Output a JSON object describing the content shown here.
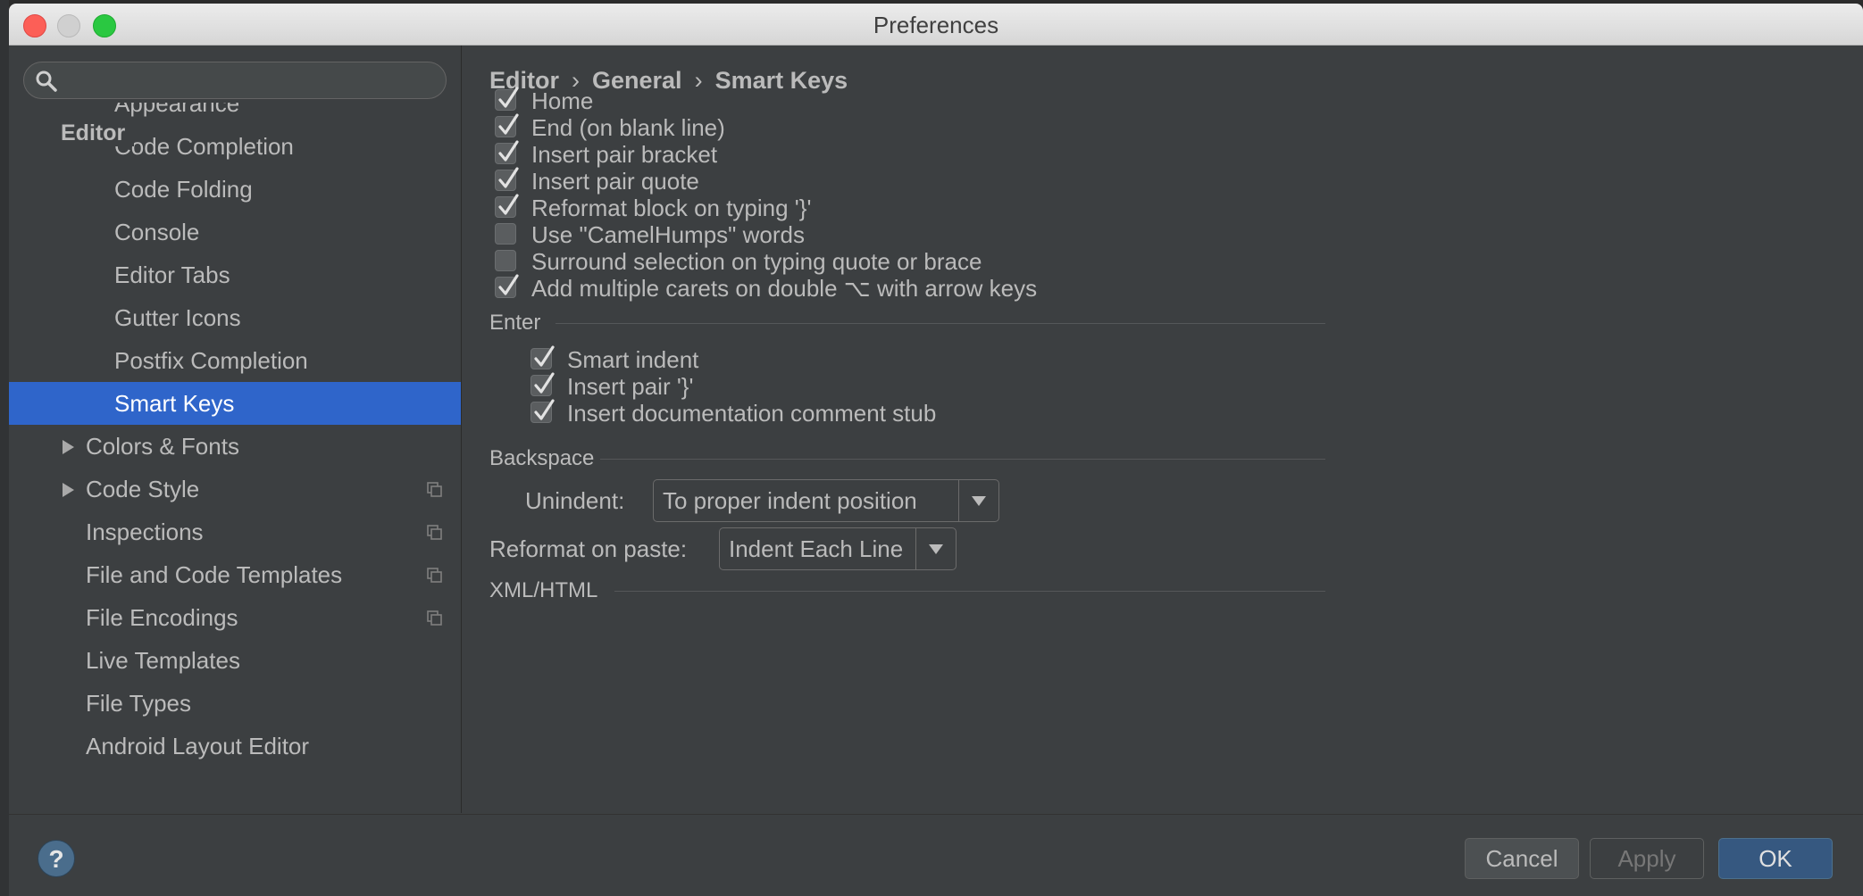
{
  "window": {
    "title": "Preferences"
  },
  "sidebar": {
    "search": {
      "placeholder": ""
    },
    "header": "Editor",
    "items": [
      {
        "label": "Appearance",
        "partial": true
      },
      {
        "label": "Code Completion"
      },
      {
        "label": "Code Folding"
      },
      {
        "label": "Console"
      },
      {
        "label": "Editor Tabs"
      },
      {
        "label": "Gutter Icons"
      },
      {
        "label": "Postfix Completion"
      },
      {
        "label": "Smart Keys",
        "selected": true
      },
      {
        "label": "Colors & Fonts",
        "expandable": true
      },
      {
        "label": "Code Style",
        "expandable": true,
        "project_icon": true
      },
      {
        "label": "Inspections",
        "project_icon": true
      },
      {
        "label": "File and Code Templates",
        "project_icon": true
      },
      {
        "label": "File Encodings",
        "project_icon": true
      },
      {
        "label": "Live Templates"
      },
      {
        "label": "File Types"
      },
      {
        "label": "Android Layout Editor"
      }
    ]
  },
  "breadcrumb": [
    "Editor",
    "General",
    "Smart Keys"
  ],
  "options": [
    {
      "label": "Home",
      "checked": true
    },
    {
      "label": "End (on blank line)",
      "checked": true
    },
    {
      "label": "Insert pair bracket",
      "checked": true
    },
    {
      "label": "Insert pair quote",
      "checked": true
    },
    {
      "label": "Reformat block on typing '}'",
      "checked": true
    },
    {
      "label": "Use \"CamelHumps\" words",
      "checked": false
    },
    {
      "label": "Surround selection on typing quote or brace",
      "checked": false
    },
    {
      "label": "Add multiple carets on double ⌥ with arrow keys",
      "checked": true
    }
  ],
  "enter": {
    "title": "Enter",
    "options": [
      {
        "label": "Smart indent",
        "checked": true
      },
      {
        "label": "Insert pair '}'",
        "checked": true
      },
      {
        "label": "Insert documentation comment stub",
        "checked": true
      }
    ]
  },
  "backspace": {
    "title": "Backspace",
    "unindent_label": "Unindent:",
    "unindent_value": "To proper indent position"
  },
  "paste": {
    "label": "Reformat on paste:",
    "value": "Indent Each Line"
  },
  "xml": {
    "title": "XML/HTML"
  },
  "footer": {
    "help": "?",
    "cancel": "Cancel",
    "apply": "Apply",
    "ok": "OK"
  },
  "colors": {
    "selection": "#2f65ca",
    "panel": "#3c3f41",
    "text": "#bbbbbb",
    "ok_button": "#365880"
  }
}
